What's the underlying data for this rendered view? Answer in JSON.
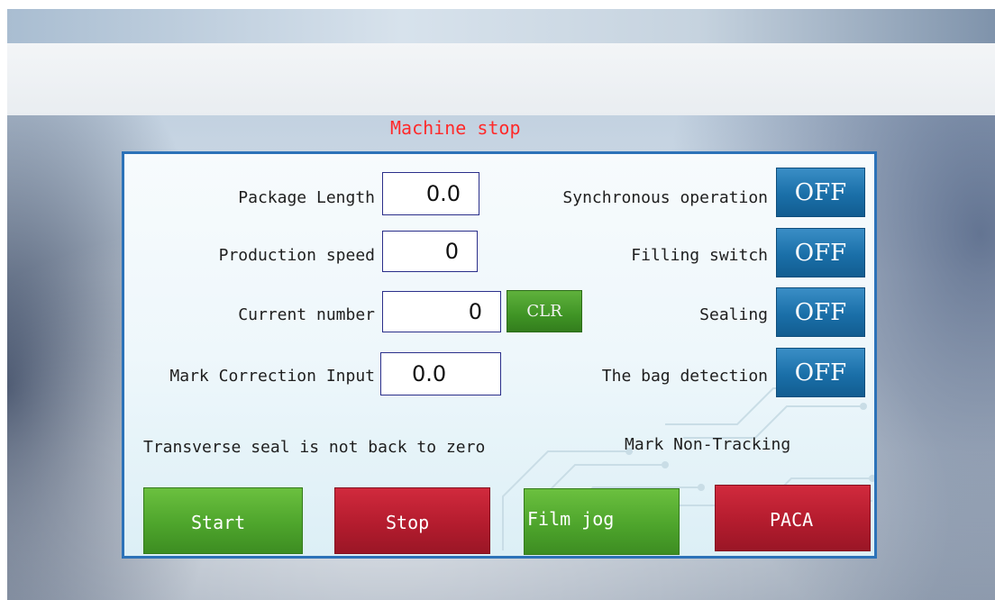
{
  "status": {
    "text": "Machine stop",
    "color": "#ff2a2a"
  },
  "fields": [
    {
      "label": "Package Length",
      "value": "0.0"
    },
    {
      "label": "Production speed",
      "value": "0"
    },
    {
      "label": "Current number",
      "value": "0"
    },
    {
      "label": "Mark Correction Input",
      "value": "0.0"
    }
  ],
  "clear_button": {
    "label": "CLR"
  },
  "toggles": [
    {
      "label": "Synchronous operation",
      "state": "OFF"
    },
    {
      "label": "Filling switch",
      "state": "OFF"
    },
    {
      "label": "Sealing",
      "state": "OFF"
    },
    {
      "label": "The bag detection",
      "state": "OFF"
    }
  ],
  "messages": {
    "transverse_seal": "Transverse seal is not back to zero",
    "mark_tracking": "Mark Non-Tracking"
  },
  "buttons": {
    "start": "Start",
    "stop": "Stop",
    "film_jog": "Film jog",
    "paca": "PACA"
  },
  "colors": {
    "panel_border": "#2c72b8",
    "toggle_off": "#1a6fa8",
    "green_button": "#4ea52c",
    "red_button": "#b41c2e"
  }
}
